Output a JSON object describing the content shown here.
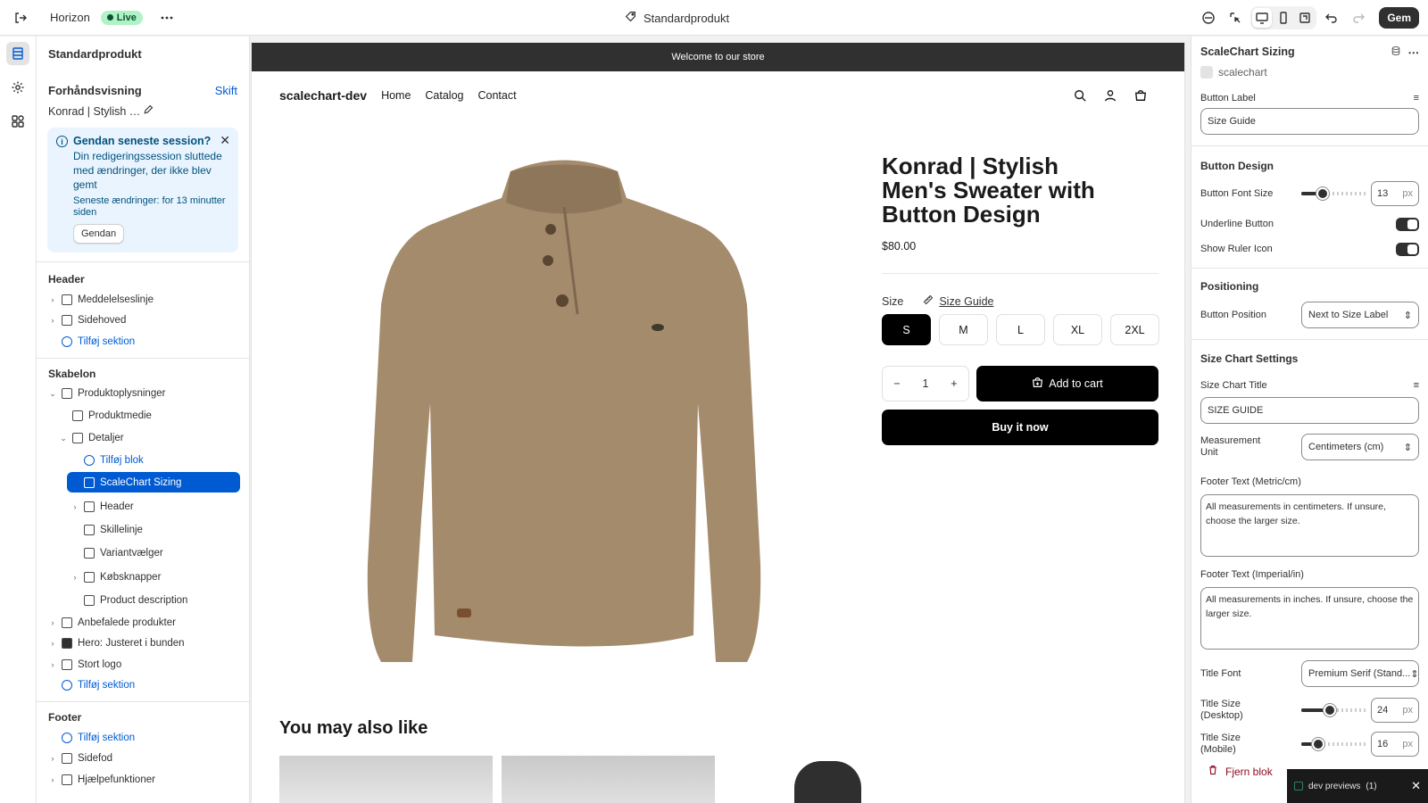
{
  "topbar": {
    "app_name": "Horizon",
    "live_label": "Live",
    "page_name": "Standardprodukt",
    "save_label": "Gem"
  },
  "sidebar": {
    "title": "Standardprodukt",
    "preview_label": "Forhåndsvisning",
    "preview_change": "Skift",
    "preview_product": "Konrad | Stylish Men's Sweater wit...",
    "banner": {
      "title": "Gendan seneste session?",
      "message": "Din redigeringssession sluttede med ændringer, der ikke blev gemt",
      "sub": "Seneste ændringer: for 13 minutter siden",
      "button": "Gendan"
    },
    "header_section": {
      "title": "Header",
      "items": [
        "Meddelelseslinje",
        "Sidehoved"
      ],
      "add": "Tilføj sektion"
    },
    "template_section": {
      "title": "Skabelon",
      "product_info": "Produktoplysninger",
      "media": "Produktmedie",
      "details": "Detaljer",
      "add_block": "Tilføj blok",
      "selected": "ScaleChart Sizing",
      "children": [
        "Header",
        "Skillelinje",
        "Variantvælger",
        "Købsknapper",
        "Product description"
      ],
      "others": [
        "Anbefalede produkter",
        "Hero: Justeret i bunden",
        "Stort logo"
      ],
      "add": "Tilføj sektion"
    },
    "footer_section": {
      "title": "Footer",
      "add": "Tilføj sektion",
      "items": [
        "Sidefod",
        "Hjælpefunktioner"
      ]
    }
  },
  "store": {
    "announcement": "Welcome to our store",
    "brand": "scalechart-dev",
    "nav": [
      "Home",
      "Catalog",
      "Contact"
    ],
    "product_title": "Konrad | Stylish Men's Sweater with Button Design",
    "price": "$80.00",
    "size_label": "Size",
    "size_guide": "Size Guide",
    "sizes": [
      "S",
      "M",
      "L",
      "XL",
      "2XL"
    ],
    "selected_size": "S",
    "quantity": "1",
    "add_to_cart": "Add to cart",
    "buy_now": "Buy it now",
    "also_like": "You may also like"
  },
  "panel": {
    "title": "ScaleChart Sizing",
    "app": "scalechart",
    "button_label_label": "Button Label",
    "button_label_value": "Size Guide",
    "button_design": "Button Design",
    "font_size_label": "Button Font Size",
    "font_size_value": "13",
    "font_size_unit": "px",
    "underline_label": "Underline Button",
    "ruler_label": "Show Ruler Icon",
    "positioning": "Positioning",
    "position_label": "Button Position",
    "position_value": "Next to Size Label",
    "chart_settings": "Size Chart Settings",
    "chart_title_label": "Size Chart Title",
    "chart_title_value": "SIZE GUIDE",
    "unit_label": "Measurement Unit",
    "unit_value": "Centimeters (cm)",
    "footer_metric_label": "Footer Text (Metric/cm)",
    "footer_metric_value": "All measurements in centimeters. If unsure, choose the larger size.",
    "footer_imperial_label": "Footer Text (Imperial/in)",
    "footer_imperial_value": "All measurements in inches. If unsure, choose the larger size.",
    "title_font_label": "Title Font",
    "title_font_value": "Premium Serif (Stand...",
    "title_size_desktop_label": "Title Size (Desktop)",
    "title_size_desktop_value": "24",
    "title_size_mobile_label": "Title Size (Mobile)",
    "title_size_mobile_value": "16",
    "unit_px": "px",
    "remove": "Fjern blok"
  },
  "toast": {
    "label": "dev previews",
    "count": "(1)"
  }
}
